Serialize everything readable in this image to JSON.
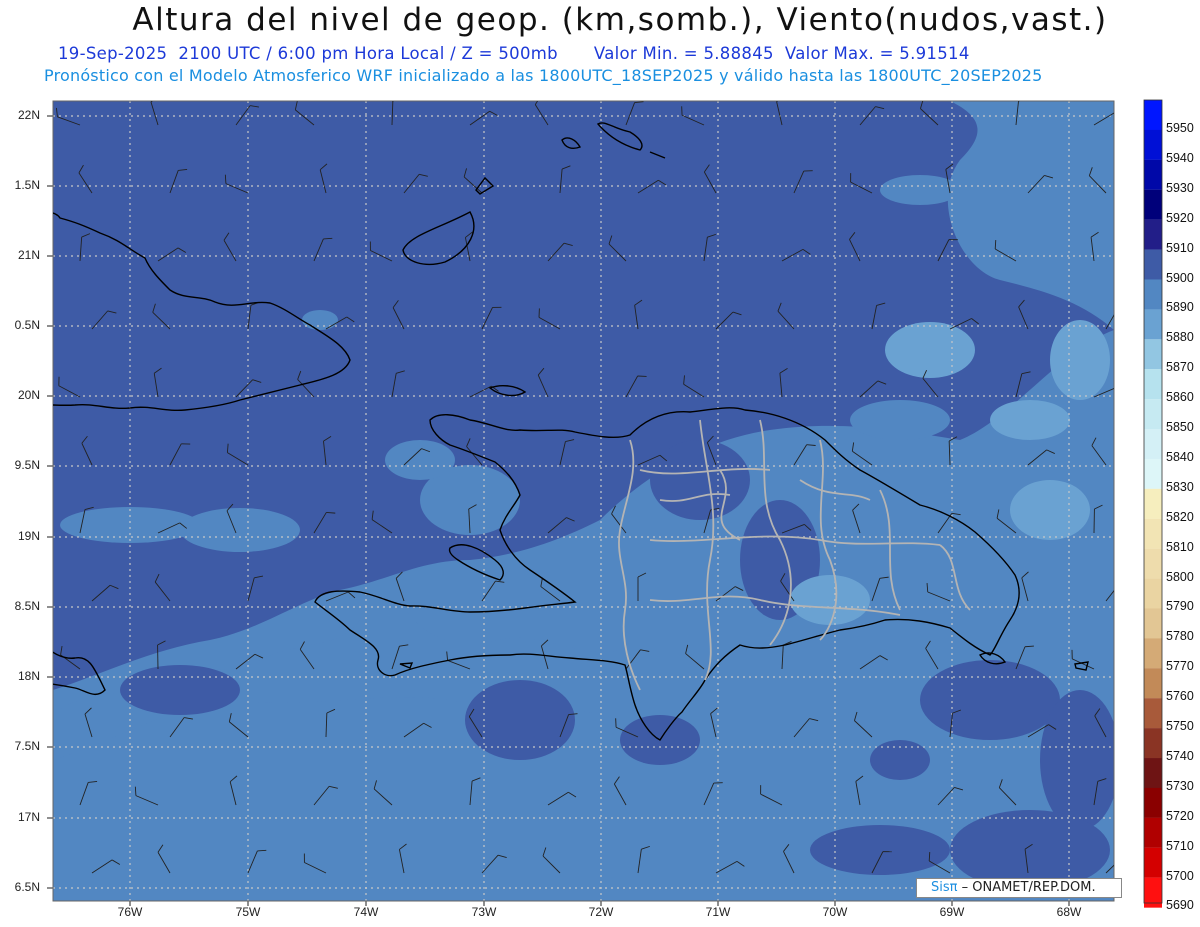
{
  "header": {
    "title": "Altura del nivel de geop. (km,somb.), Viento(nudos,vast.)",
    "date": "19-Sep-2025",
    "time": "2100 UTC / 6:00 pm Hora Local / Z = 500mb",
    "min": "Valor Min. = 5.88845",
    "max": "Valor Max. = 5.91514",
    "model_line": "Pronóstico con el Modelo Atmosferico WRF inicializado a las 1800UTC_18SEP2025 y válido hasta las  1800UTC_20SEP2025"
  },
  "map": {
    "lat_labels": [
      "22N",
      "1.5N",
      "21N",
      "0.5N",
      "20N",
      "9.5N",
      "19N",
      "8.5N",
      "18N",
      "7.5N",
      "17N",
      "6.5N"
    ],
    "lon_labels": [
      "76W",
      "75W",
      "74W",
      "73W",
      "72W",
      "71W",
      "70W",
      "69W",
      "68W"
    ],
    "colors": {
      "base": "#3e5ba6",
      "light": "#5287c2",
      "lighter": "#6aa2d2",
      "pale": "#b8e4f0",
      "coast": "#000000",
      "provinces": "#b4b4b4"
    }
  },
  "colorbar": {
    "levels": [
      "5950",
      "5940",
      "5930",
      "5920",
      "5910",
      "5900",
      "5890",
      "5880",
      "5870",
      "5860",
      "5850",
      "5840",
      "5830",
      "5820",
      "5810",
      "5800",
      "5790",
      "5780",
      "5770",
      "5760",
      "5750",
      "5740",
      "5730",
      "5720",
      "5710",
      "5700",
      "5690"
    ],
    "colors": [
      "#0016ff",
      "#0010d6",
      "#0008a8",
      "#00007a",
      "#221e88",
      "#3e5ba6",
      "#5287c2",
      "#6aa2d2",
      "#92c6e2",
      "#b6e2ee",
      "#c6eaf2",
      "#d4f0f6",
      "#ddf6f8",
      "#f6eebe",
      "#f2e4b4",
      "#eedcac",
      "#ead4a2",
      "#e2c694",
      "#d4aa76",
      "#c28a58",
      "#a85a3a",
      "#8a3424",
      "#6e1414",
      "#8a0000",
      "#b00000",
      "#d40000",
      "#ff1010"
    ]
  },
  "credit": {
    "sis": "Sisπ",
    "rest": " – ONAMET/REP.DOM."
  }
}
